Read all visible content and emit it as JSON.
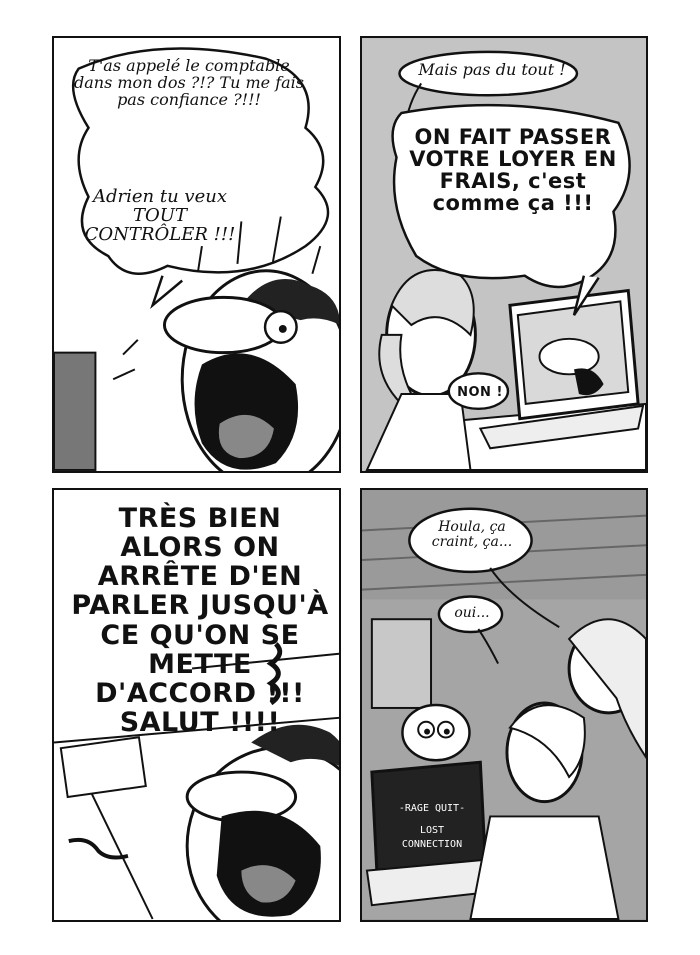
{
  "panels": [
    {
      "bubbles": [
        "T'as appelé le comptable dans mon dos ?!? Tu me fais pas confiance ?!!!",
        "Adrien tu veux TOUT CONTRÔLER !!!"
      ]
    },
    {
      "bubbles": [
        "Mais pas du tout !",
        "ON FAIT PASSER VOTRE LOYER EN FRAIS, c'est comme ça !!!",
        "NON !"
      ]
    },
    {
      "bubbles": [
        "TRÈS BIEN ALORS ON ARRÊTE D'EN PARLER JUSQU'À CE QU'ON SE METTE D'ACCORD !!! SALUT !!!!"
      ]
    },
    {
      "bubbles": [
        "Houla, ça craint, ça...",
        "oui..."
      ],
      "laptop_screen": {
        "line1": "-RAGE QUIT-",
        "line2": "LOST",
        "line3": "CONNECTION"
      }
    }
  ]
}
